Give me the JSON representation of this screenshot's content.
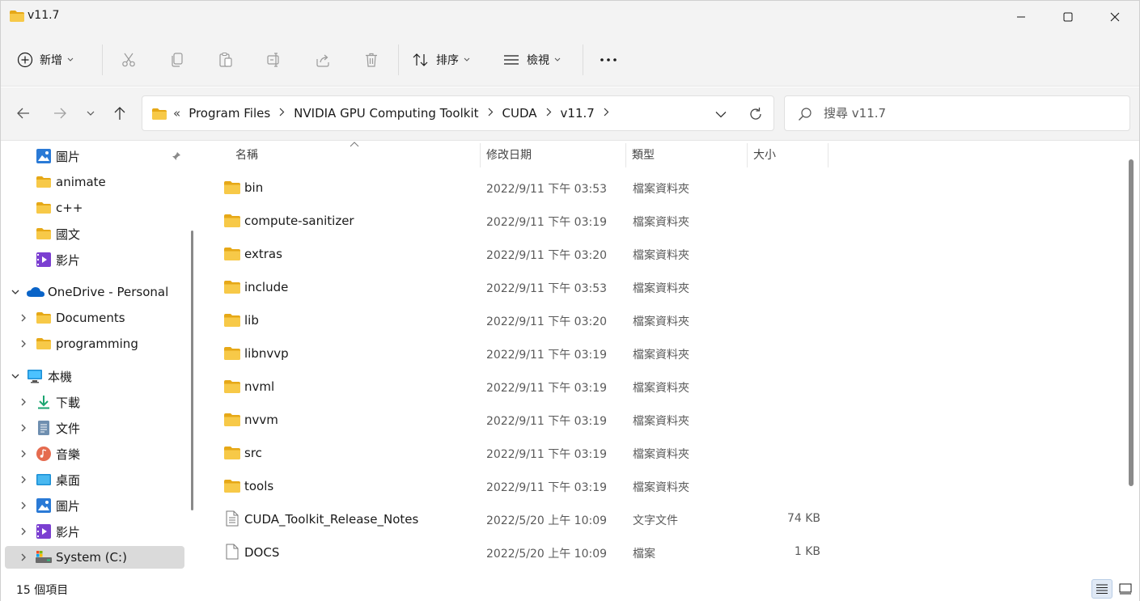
{
  "window": {
    "title": "v11.7",
    "controls": {
      "minimize": "minimize",
      "maximize": "maximize",
      "close": "close"
    }
  },
  "commandbar": {
    "new_label": "新增",
    "sort_label": "排序",
    "view_label": "檢視",
    "icons": [
      "cut-icon",
      "copy-icon",
      "paste-icon",
      "rename-icon",
      "share-icon",
      "delete-icon",
      "more-icon"
    ]
  },
  "address": {
    "overflow": "«",
    "crumbs": [
      "Program Files",
      "NVIDIA GPU Computing Toolkit",
      "CUDA",
      "v11.7"
    ]
  },
  "search": {
    "placeholder": "搜尋 v11.7"
  },
  "sidebar": {
    "items": [
      {
        "label": "圖片",
        "icon": "pictures-icon"
      },
      {
        "label": "animate",
        "icon": "folder-icon"
      },
      {
        "label": "c++",
        "icon": "folder-icon"
      },
      {
        "label": "國文",
        "icon": "folder-icon"
      },
      {
        "label": "影片",
        "icon": "videos-icon"
      },
      {
        "label": "OneDrive - Personal",
        "icon": "onedrive-icon"
      },
      {
        "label": "Documents",
        "icon": "folder-icon"
      },
      {
        "label": "programming",
        "icon": "folder-icon"
      },
      {
        "label": "本機",
        "icon": "this-pc-icon"
      },
      {
        "label": "下載",
        "icon": "downloads-icon"
      },
      {
        "label": "文件",
        "icon": "documents-icon"
      },
      {
        "label": "音樂",
        "icon": "music-icon"
      },
      {
        "label": "桌面",
        "icon": "desktop-icon"
      },
      {
        "label": "圖片",
        "icon": "pictures-icon"
      },
      {
        "label": "影片",
        "icon": "videos-icon"
      },
      {
        "label": "System (C:)",
        "icon": "drive-icon"
      }
    ]
  },
  "list": {
    "columns": {
      "name": "名稱",
      "date": "修改日期",
      "type": "類型",
      "size": "大小"
    },
    "rows": [
      {
        "name": "bin",
        "date": "2022/9/11 下午 03:53",
        "type": "檔案資料夾",
        "size": "",
        "kind": "folder"
      },
      {
        "name": "compute-sanitizer",
        "date": "2022/9/11 下午 03:19",
        "type": "檔案資料夾",
        "size": "",
        "kind": "folder"
      },
      {
        "name": "extras",
        "date": "2022/9/11 下午 03:20",
        "type": "檔案資料夾",
        "size": "",
        "kind": "folder"
      },
      {
        "name": "include",
        "date": "2022/9/11 下午 03:53",
        "type": "檔案資料夾",
        "size": "",
        "kind": "folder"
      },
      {
        "name": "lib",
        "date": "2022/9/11 下午 03:20",
        "type": "檔案資料夾",
        "size": "",
        "kind": "folder"
      },
      {
        "name": "libnvvp",
        "date": "2022/9/11 下午 03:19",
        "type": "檔案資料夾",
        "size": "",
        "kind": "folder"
      },
      {
        "name": "nvml",
        "date": "2022/9/11 下午 03:19",
        "type": "檔案資料夾",
        "size": "",
        "kind": "folder"
      },
      {
        "name": "nvvm",
        "date": "2022/9/11 下午 03:19",
        "type": "檔案資料夾",
        "size": "",
        "kind": "folder"
      },
      {
        "name": "src",
        "date": "2022/9/11 下午 03:19",
        "type": "檔案資料夾",
        "size": "",
        "kind": "folder"
      },
      {
        "name": "tools",
        "date": "2022/9/11 下午 03:19",
        "type": "檔案資料夾",
        "size": "",
        "kind": "folder"
      },
      {
        "name": "CUDA_Toolkit_Release_Notes",
        "date": "2022/5/20 上午 10:09",
        "type": "文字文件",
        "size": "74 KB",
        "kind": "text"
      },
      {
        "name": "DOCS",
        "date": "2022/5/20 上午 10:09",
        "type": "檔案",
        "size": "1 KB",
        "kind": "file"
      }
    ]
  },
  "status": {
    "count_text": "15 個項目"
  },
  "colors": {
    "folder": "#f7c948",
    "folder_dark": "#e6a817",
    "accent": "#0067c0",
    "chrome_bg": "#f3f3f3"
  }
}
